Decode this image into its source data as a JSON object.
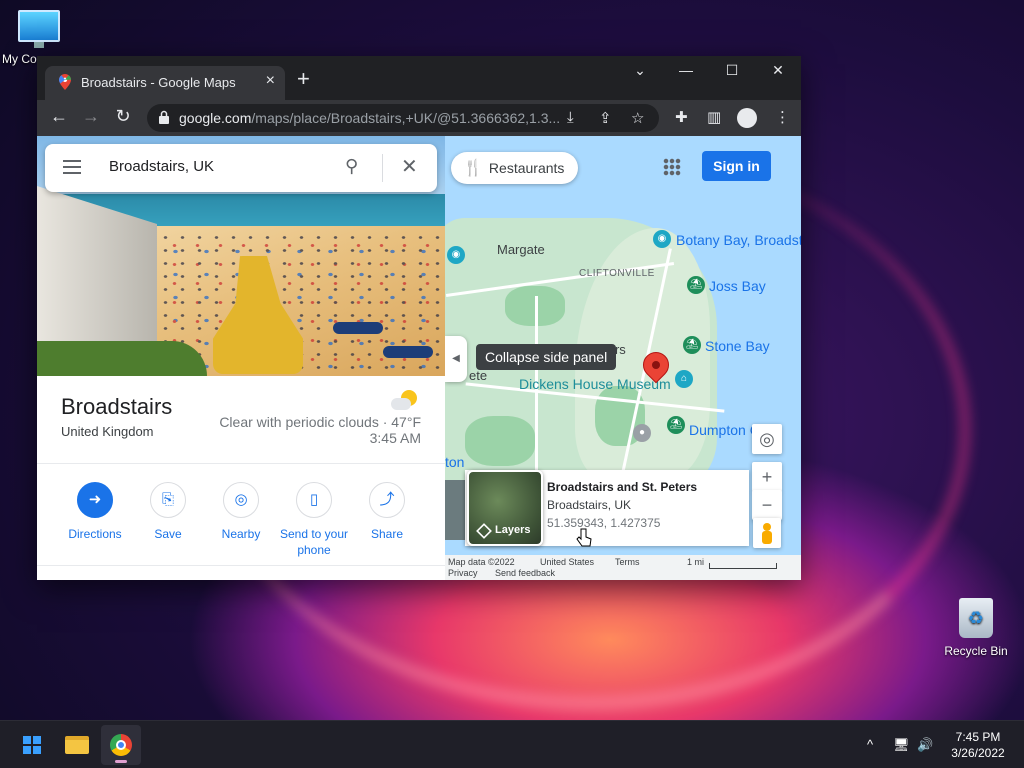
{
  "desktop": {
    "icons": [
      {
        "label": "My Co",
        "icon": "computer-icon"
      },
      {
        "label": "Recycle Bin",
        "icon": "recycle-bin-icon"
      }
    ]
  },
  "browser": {
    "tab": {
      "title": "Broadstairs - Google Maps",
      "icon": "google-maps-icon"
    },
    "new_tab": "+",
    "window_controls": {
      "minimize": "—",
      "maximize": "☐",
      "close": "✕",
      "tab_search": "⌄"
    },
    "url_host": "google.com",
    "url_path": "/maps/place/Broadstairs,+UK/@51.3666362,1.3...",
    "nav": {
      "back": "←",
      "forward": "→",
      "reload": "↻"
    }
  },
  "maps": {
    "search": {
      "value": "Broadstairs, UK",
      "search_icon": "⌕",
      "clear": "✕"
    },
    "place": {
      "name": "Broadstairs",
      "country": "United Kingdom",
      "weather": "Clear with periodic clouds · 47°F",
      "time": "3:45 AM"
    },
    "actions": [
      {
        "label": "Directions",
        "icon": "directions-icon",
        "glyph": "➜"
      },
      {
        "label": "Save",
        "icon": "bookmark-icon",
        "glyph": "🔖"
      },
      {
        "label": "Nearby",
        "icon": "nearby-icon",
        "glyph": "◎"
      },
      {
        "label": "Send to your phone",
        "icon": "phone-icon",
        "glyph": "▯"
      },
      {
        "label": "Share",
        "icon": "share-icon",
        "glyph": "⋖"
      }
    ],
    "map": {
      "restaurants_chip": "Restaurants",
      "signin": "Sign in",
      "labels": {
        "margate": "Margate",
        "cliftonville": "CLIFTONVILLE",
        "botany_bay": "Botany Bay, Broadst",
        "joss_bay": "Joss Bay",
        "stone_bay": "Stone Bay",
        "dickens": "Dickens House Museum",
        "dumpton": "Dumpton G",
        "peters_partial": "t Peters",
        "left_partial": "ete",
        "left_partial2": "ton"
      },
      "tooltip": "Collapse side panel",
      "zoom_in": "+",
      "zoom_out": "−",
      "locate": "◎",
      "layers_label": "Layers",
      "info_card": {
        "title": "Broadstairs and St. Peters",
        "subtitle": "Broadstairs, UK",
        "coords": "51.359343, 1.427375"
      },
      "attribution": {
        "map_data": "Map data ©2022",
        "country": "United States",
        "terms": "Terms",
        "privacy": "Privacy",
        "feedback": "Send feedback",
        "scale": "1 mi"
      }
    }
  },
  "taskbar": {
    "tray_chevron": "^",
    "time": "7:45 PM",
    "date": "3/26/2022"
  },
  "colors": {
    "accent": "#1a73e8",
    "pin": "#ea4335",
    "poi": "#1e8e5a"
  }
}
